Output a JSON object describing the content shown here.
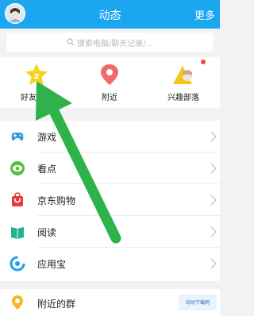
{
  "header": {
    "title": "动态",
    "more": "更多"
  },
  "search": {
    "placeholder": "搜索电脑/聊天记录/..."
  },
  "quick": [
    {
      "label": "好友动态",
      "icon": "star-z-icon"
    },
    {
      "label": "附近",
      "icon": "location-pin-icon"
    },
    {
      "label": "兴趣部落",
      "icon": "tribe-icon"
    }
  ],
  "list": [
    {
      "label": "游戏",
      "icon": "gamepad-icon"
    },
    {
      "label": "看点",
      "icon": "eye-icon"
    },
    {
      "label": "京东购物",
      "icon": "jd-bag-icon"
    },
    {
      "label": "阅读",
      "icon": "book-icon"
    },
    {
      "label": "应用宝",
      "icon": "app-store-icon"
    }
  ],
  "bottom": {
    "label": "附近的群",
    "icon": "nearby-group-icon",
    "watermark": "动动下载网"
  },
  "colors": {
    "header": "#1aa7f0",
    "arrow": "#2eb34a",
    "badge": "#f04848"
  }
}
